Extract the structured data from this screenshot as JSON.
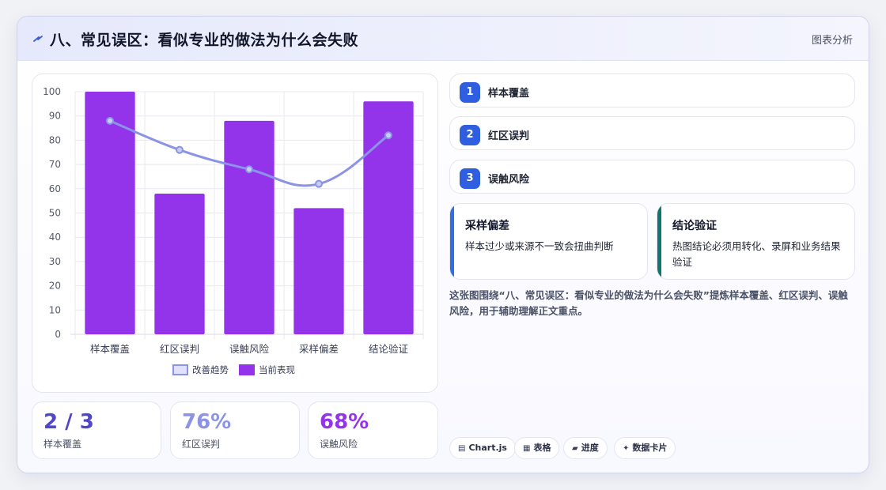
{
  "header": {
    "title": "八、常见误区：看似专业的做法为什么会失败",
    "tag": "图表分析"
  },
  "chart_data": {
    "type": "bar",
    "categories": [
      "样本覆盖",
      "红区误判",
      "误触风险",
      "采样偏差",
      "结论验证"
    ],
    "series": [
      {
        "name": "当前表现",
        "type": "bar",
        "color": "#9333ea",
        "values": [
          100,
          58,
          88,
          52,
          96
        ]
      },
      {
        "name": "改善趋势",
        "type": "line",
        "color": "#8b93e6",
        "values": [
          88,
          76,
          68,
          62,
          82
        ]
      }
    ],
    "ylim": [
      0,
      100
    ],
    "yticks": [
      0,
      10,
      20,
      30,
      40,
      50,
      60,
      70,
      80,
      90,
      100
    ],
    "grid": true,
    "legend": "bottom",
    "legend_items": [
      "改善趋势",
      "当前表现"
    ]
  },
  "stats": [
    {
      "value": "2 / 3",
      "label": "样本覆盖",
      "color": "#4f46c8"
    },
    {
      "value": "76%",
      "label": "红区误判",
      "color": "#8b93e6"
    },
    {
      "value": "68%",
      "label": "误触风险",
      "color": "#9333ea"
    }
  ],
  "steps": [
    {
      "num": "1",
      "label": "样本覆盖"
    },
    {
      "num": "2",
      "label": "红区误判"
    },
    {
      "num": "3",
      "label": "误触风险"
    }
  ],
  "info_cards": [
    {
      "title": "采样偏差",
      "body": "样本过少或来源不一致会扭曲判断",
      "accent": "#2f6fe0"
    },
    {
      "title": "结论验证",
      "body": "热图结论必须用转化、录屏和业务结果验证",
      "accent": "#0f766e"
    }
  ],
  "description": "这张图围绕“八、常见误区：看似专业的做法为什么会失败”提炼样本覆盖、红区误判、误触风险，用于辅助理解正文重点。",
  "chips": [
    {
      "icon": "▤",
      "label": "Chart.js",
      "icon_name": "chart-icon"
    },
    {
      "icon": "▦",
      "label": "表格",
      "icon_name": "table-icon"
    },
    {
      "icon": "▰",
      "label": "进度",
      "icon_name": "progress-icon"
    },
    {
      "icon": "✦",
      "label": "数据卡片",
      "icon_name": "sparkle-icon"
    }
  ]
}
